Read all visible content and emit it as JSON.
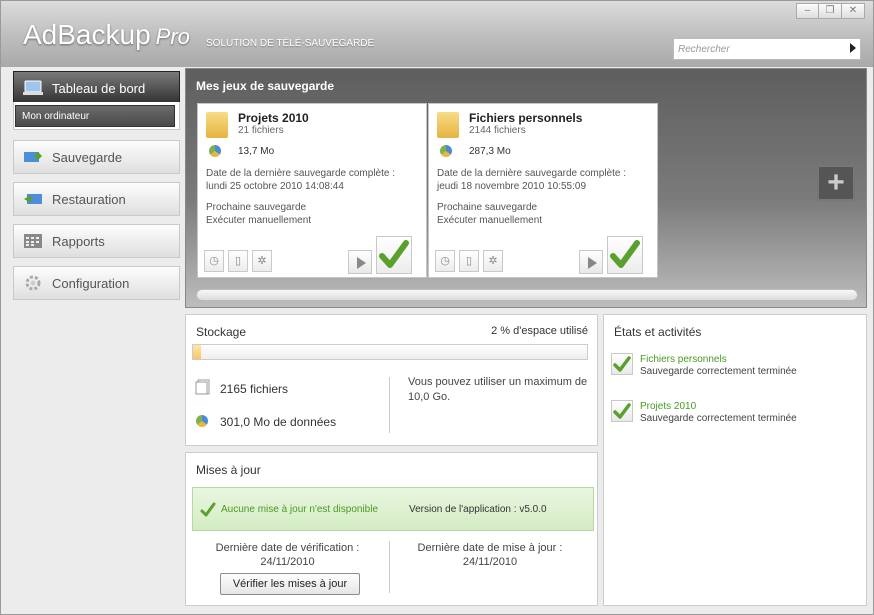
{
  "app": {
    "name": "AdBackup",
    "edition": "Pro",
    "tagline": "SOLUTION DE TÉLÉ-SAUVEGARDE"
  },
  "search": {
    "placeholder": "Rechercher"
  },
  "nav": {
    "active": "Tableau de bord",
    "sub_active": "Mon ordinateur",
    "items": [
      "Sauvegarde",
      "Restauration",
      "Rapports",
      "Configuration"
    ]
  },
  "backup_sets": {
    "title": "Mes jeux de sauvegarde",
    "cards": [
      {
        "name": "Projets 2010",
        "files": "21 fichiers",
        "size": "13,7 Mo",
        "last_label": "Date de la dernière sauvegarde complète :",
        "last_date": "lundi 25 octobre 2010 14:08:44",
        "next_label": "Prochaine sauvegarde",
        "next_value": "Exécuter manuellement"
      },
      {
        "name": "Fichiers personnels",
        "files": "2144 fichiers",
        "size": "287,3 Mo",
        "last_label": "Date de la dernière sauvegarde complète :",
        "last_date": "jeudi 18 novembre 2010 10:55:09",
        "next_label": "Prochaine sauvegarde",
        "next_value": "Exécuter manuellement"
      }
    ]
  },
  "storage": {
    "title": "Stockage",
    "usage_text": "2 % d'espace utilisé",
    "usage_percent": 2,
    "files": "2165 fichiers",
    "data": "301,0 Mo de données",
    "max_info": "Vous pouvez utiliser un maximum de 10,0 Go."
  },
  "updates": {
    "title": "Mises à jour",
    "status": "Aucune mise à jour n'est disponible",
    "version": "Version de l'application : v5.0.0",
    "check_label": "Dernière date de vérification :",
    "check_date": "24/11/2010",
    "update_label": "Dernière date de mise à jour :",
    "update_date": "24/11/2010",
    "button": "Vérifier les mises à jour"
  },
  "activity": {
    "title": "États et activités",
    "items": [
      {
        "name": "Fichiers personnels",
        "status": "Sauvegarde correctement terminée"
      },
      {
        "name": "Projets 2010",
        "status": "Sauvegarde correctement terminée"
      }
    ]
  },
  "colors": {
    "accent_green": "#5aa02c",
    "link_green": "#4a9a22"
  }
}
